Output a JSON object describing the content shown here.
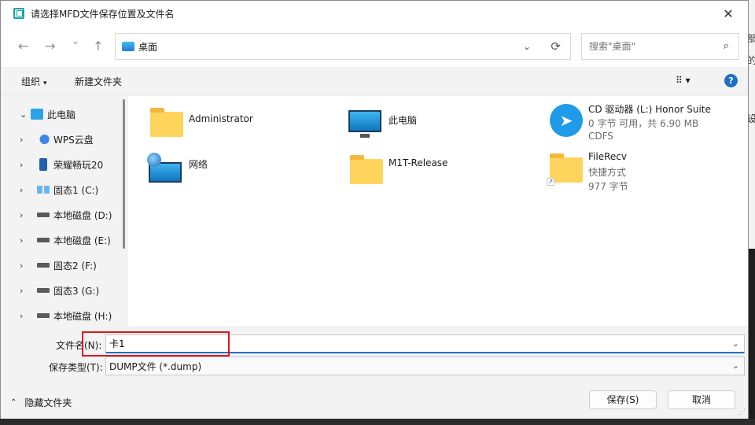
{
  "window": {
    "title": "请选择MFD文件保存位置及文件名",
    "close_glyph": "✕"
  },
  "nav": {
    "back_glyph": "←",
    "forward_glyph": "→",
    "recent_glyph": "⌄",
    "up_glyph": "↑",
    "address_text": "桌面",
    "address_chevron": "⌄",
    "refresh_glyph": "⟳",
    "search_placeholder": "搜索\"桌面\"",
    "search_glyph": "⌕"
  },
  "toolbar": {
    "organize_label": "组织",
    "new_folder_label": "新建文件夹",
    "view_glyph": "⠿ ▾",
    "help_glyph": "?",
    "caret_glyph": "▾"
  },
  "sidebar": {
    "items": [
      {
        "chevron": "⌄",
        "label": "此电脑"
      },
      {
        "chevron": "›",
        "label": "WPS云盘"
      },
      {
        "chevron": "›",
        "label": "荣耀畅玩20"
      },
      {
        "chevron": "›",
        "label": "固态1 (C:)"
      },
      {
        "chevron": "›",
        "label": "本地磁盘 (D:)"
      },
      {
        "chevron": "›",
        "label": "本地磁盘 (E:)"
      },
      {
        "chevron": "›",
        "label": "固态2 (F:)"
      },
      {
        "chevron": "›",
        "label": "固态3 (G:)"
      },
      {
        "chevron": "›",
        "label": "本地磁盘 (H:)"
      }
    ]
  },
  "files": [
    {
      "name": "Administrator",
      "icon": "folder-icon"
    },
    {
      "name": "此电脑",
      "icon": "monitor-icon"
    },
    {
      "name": "CD 驱动器 (L:) Honor Suite",
      "line2": "0 字节 可用，共 6.90 MB",
      "line3": "CDFS",
      "icon": "cd-drive-icon"
    },
    {
      "name": "网络",
      "icon": "network-icon"
    },
    {
      "name": "M1T-Release",
      "icon": "folder-icon"
    },
    {
      "name": "FileRecv",
      "line2": "快捷方式",
      "line3": "977 字节",
      "icon": "folder-shortcut-icon",
      "shortcut_glyph": "↗"
    }
  ],
  "bottom": {
    "filename_label": "文件名(N):",
    "filename_value": "卡1",
    "filetype_label": "保存类型(T):",
    "filetype_value": "DUMP文件 (*.dump)",
    "dropdown_glyph": "⌄",
    "hide_folders_label": "隐藏文件夹",
    "hide_caret": "⌃",
    "save_label": "保存(S)",
    "cancel_label": "取消",
    "grip_glyph": "⋰"
  },
  "background": {
    "glyph1": "部",
    "glyph2": "的",
    "glyph3": "设"
  },
  "colors": {
    "accent": "#1f6fc4",
    "highlight_box": "#e0141e"
  }
}
